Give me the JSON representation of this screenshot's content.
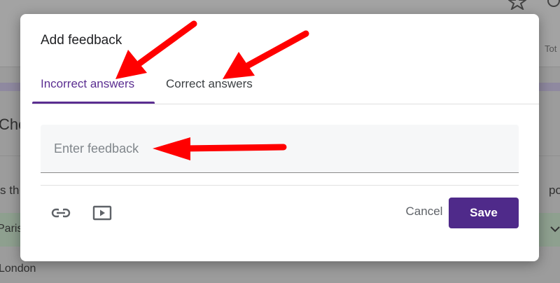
{
  "background": {
    "top_right_label": "Tot",
    "heading_fragment": "Cho",
    "question_fragment": "s th",
    "points_fragment": "po",
    "option_selected": "Paris",
    "option_next": "London"
  },
  "dialog": {
    "title": "Add feedback",
    "tabs": [
      {
        "label": "Incorrect answers",
        "active": true
      },
      {
        "label": "Correct answers",
        "active": false
      }
    ],
    "feedback_input": {
      "placeholder": "Enter feedback",
      "value": ""
    },
    "cancel_label": "Cancel",
    "save_label": "Save"
  },
  "icons": {
    "link": "link-icon",
    "video": "video-icon",
    "star": "star-icon",
    "chevron": "chevron-down-icon"
  },
  "colors": {
    "accent": "#5b2e91",
    "save_button": "#4f2a8a",
    "annotation_arrows": "#ff0000"
  }
}
